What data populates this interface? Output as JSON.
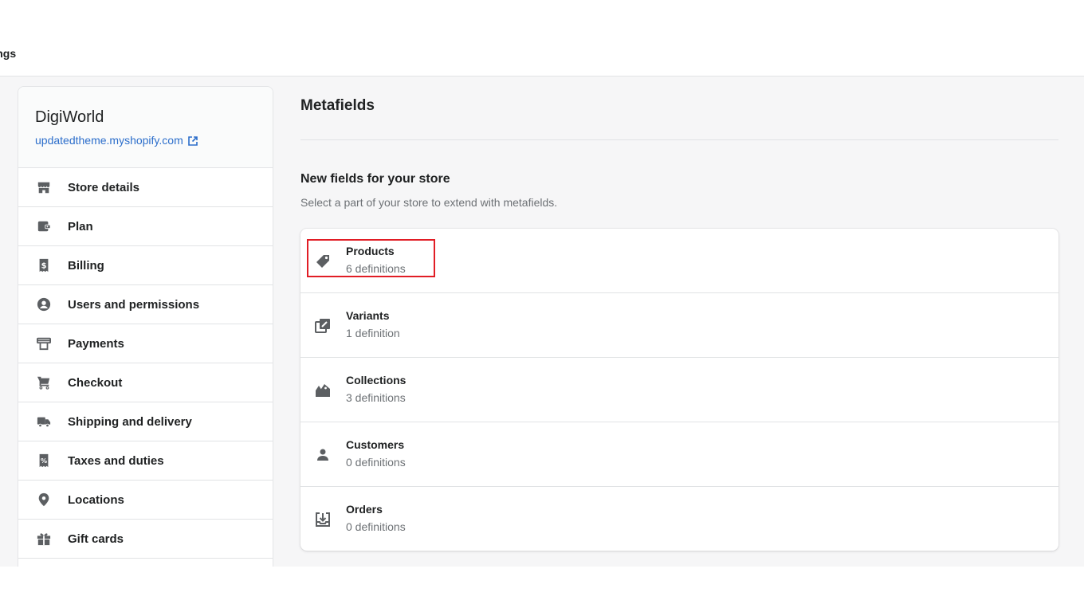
{
  "topbar": {
    "title": "ttings"
  },
  "sidebar": {
    "store_name": "DigiWorld",
    "store_url": "updatedtheme.myshopify.com",
    "items": [
      {
        "label": "Store details",
        "icon": "store-icon"
      },
      {
        "label": "Plan",
        "icon": "plan-icon"
      },
      {
        "label": "Billing",
        "icon": "billing-icon"
      },
      {
        "label": "Users and permissions",
        "icon": "user-circle-icon"
      },
      {
        "label": "Payments",
        "icon": "payments-icon"
      },
      {
        "label": "Checkout",
        "icon": "cart-icon"
      },
      {
        "label": "Shipping and delivery",
        "icon": "truck-icon"
      },
      {
        "label": "Taxes and duties",
        "icon": "tax-icon"
      },
      {
        "label": "Locations",
        "icon": "location-pin-icon"
      },
      {
        "label": "Gift cards",
        "icon": "gift-icon"
      }
    ]
  },
  "main": {
    "title": "Metafields",
    "section_heading": "New fields for your store",
    "section_subtitle": "Select a part of your store to extend with metafields.",
    "rows": [
      {
        "title": "Products",
        "count": "6 definitions",
        "icon": "tag-icon",
        "highlighted": true
      },
      {
        "title": "Variants",
        "count": "1 definition",
        "icon": "variants-icon"
      },
      {
        "title": "Collections",
        "count": "3 definitions",
        "icon": "collections-icon"
      },
      {
        "title": "Customers",
        "count": "0 definitions",
        "icon": "customer-icon"
      },
      {
        "title": "Orders",
        "count": "0 definitions",
        "icon": "orders-icon"
      }
    ]
  },
  "colors": {
    "link": "#2c6ecb",
    "highlight_border": "#e11d25",
    "workspace_bg": "#f6f6f7",
    "icon": "#5c5f62"
  }
}
